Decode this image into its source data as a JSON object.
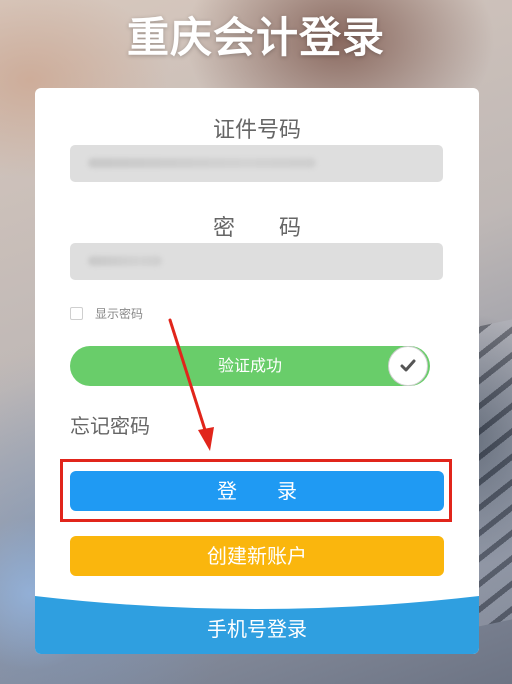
{
  "header": {
    "title": "重庆会计登录"
  },
  "form": {
    "id_label": "证件号码",
    "password_label": "密　　码",
    "show_password_label": "显示密码",
    "verify_text": "验证成功",
    "forgot_label": "忘记密码",
    "login_label": "登　　录",
    "create_account_label": "创建新账户",
    "phone_login_label": "手机号登录"
  },
  "colors": {
    "verify_green": "#69cd6a",
    "login_blue": "#1f9af3",
    "create_orange": "#fab60d",
    "phone_bar_blue": "#2f9fe0",
    "annotation_red": "#e1251b"
  },
  "icons": {
    "verify_knob": "check-icon",
    "annotation": "arrow-icon"
  }
}
